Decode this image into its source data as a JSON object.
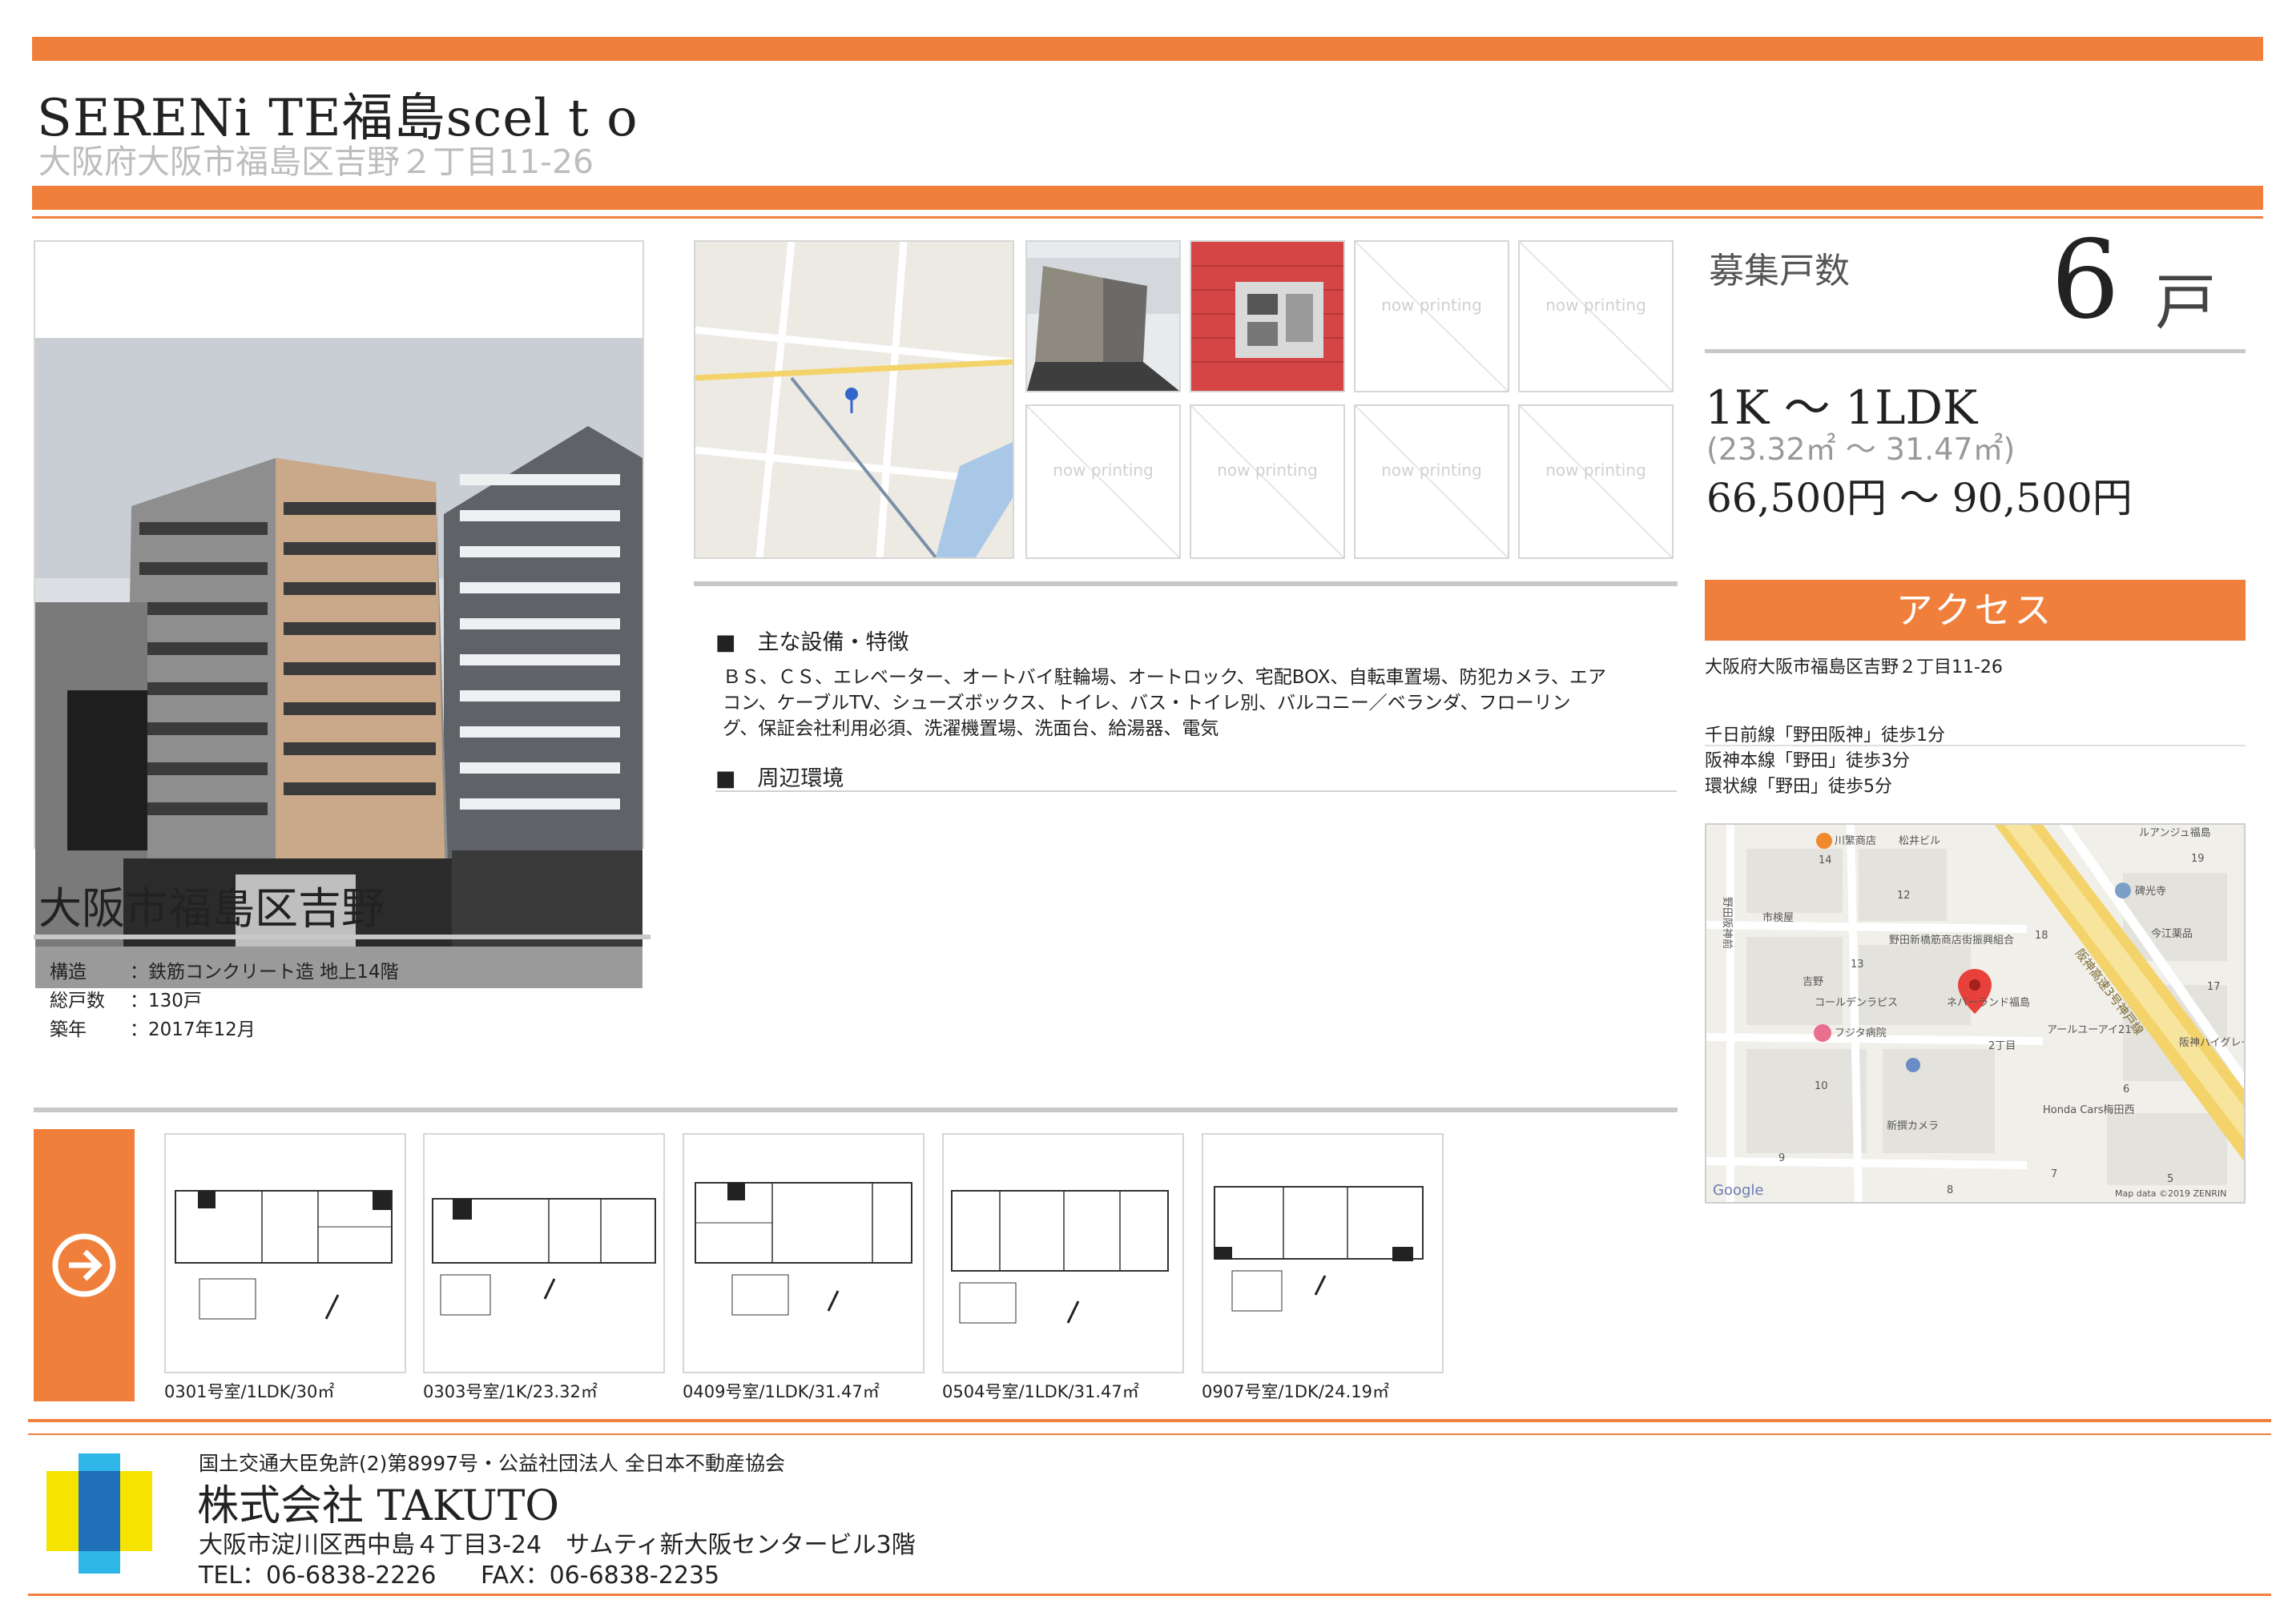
{
  "header": {
    "building_name": "SERENi TE福島scel t o",
    "address": "大阪府大阪市福島区吉野２丁目11-26"
  },
  "photos": {
    "map_label": "地図",
    "placeholder_text": "now printing"
  },
  "recruit": {
    "label": "募集戸数",
    "count": "6",
    "unit": "戸",
    "layout_range": "1K ～ 1LDK",
    "area_range": "(23.32㎡ ～ 31.47㎡)",
    "rent_range": "66,500円 ～ 90,500円"
  },
  "access": {
    "title": "アクセス",
    "address": "大阪府大阪市福島区吉野２丁目11-26",
    "stations": [
      "千日前線「野田阪神」徒歩1分",
      "阪神本線「野田」徒歩3分",
      "環状線「野田」徒歩5分"
    ],
    "map": {
      "labels": [
        "川繁商店",
        "松井ビル",
        "ルアンジュ福島",
        "19",
        "14",
        "12",
        "碑光寺",
        "市検屋",
        "野田新橋筋商店街振興組合",
        "18",
        "今江薬品",
        "13",
        "吉野",
        "コールデンラピス",
        "フジタ病院",
        "ネバーランド福島",
        "17",
        "2丁目",
        "アールユーアイ21",
        "阪神ハイグレーマンション7番",
        "10",
        "新撰カメラ",
        "Honda Cars梅田西",
        "6",
        "9",
        "8",
        "7",
        "5",
        "阪神高速3号神戸線",
        "野田阪神前",
        "Google",
        "Map data ©2019 ZENRIN"
      ]
    }
  },
  "features": {
    "equipment_title": "■　主な設備・特徴",
    "equipment_lines": [
      "ＢＳ、ＣＳ、エレベーター、オートバイ駐輪場、オートロック、宅配BOX、自転車置場、防犯カメラ、エア",
      "コン、ケーブルTV、シューズボックス、トイレ、バス・トイレ別、バルコニー／ベランダ、フローリン",
      "グ、保証会社利用必須、洗濯機置場、洗面台、給湯器、電気"
    ],
    "surroundings_title": "■　周辺環境"
  },
  "location": {
    "area": "大阪市福島区吉野",
    "specs": [
      {
        "key": "構造",
        "value": "：鉄筋コンクリート造 地上14階"
      },
      {
        "key": "総戸数",
        "value": "：130戸"
      },
      {
        "key": "築年",
        "value": "：2017年12月"
      }
    ]
  },
  "floorplans": [
    {
      "caption": "0301号室/1LDK/30㎡"
    },
    {
      "caption": "0303号室/1K/23.32㎡"
    },
    {
      "caption": "0409号室/1LDK/31.47㎡"
    },
    {
      "caption": "0504号室/1LDK/31.47㎡"
    },
    {
      "caption": "0907号室/1DK/24.19㎡"
    }
  ],
  "footer": {
    "license": "国土交通大臣免許(2)第8997号・公益社団法人 全日本不動産協会",
    "company": "株式会社 TAKUTO",
    "address": "大阪市淀川区西中島４丁目3-24　サムティ新大阪センタービル3階",
    "tel": "TEL：06-6838-2226",
    "fax": "FAX：06-6838-2235"
  },
  "colors": {
    "accent": "#f07f3c",
    "logo_yellow": "#f6e400",
    "logo_blue": "#1f6fb9",
    "logo_cyan": "#2fb6e8"
  }
}
